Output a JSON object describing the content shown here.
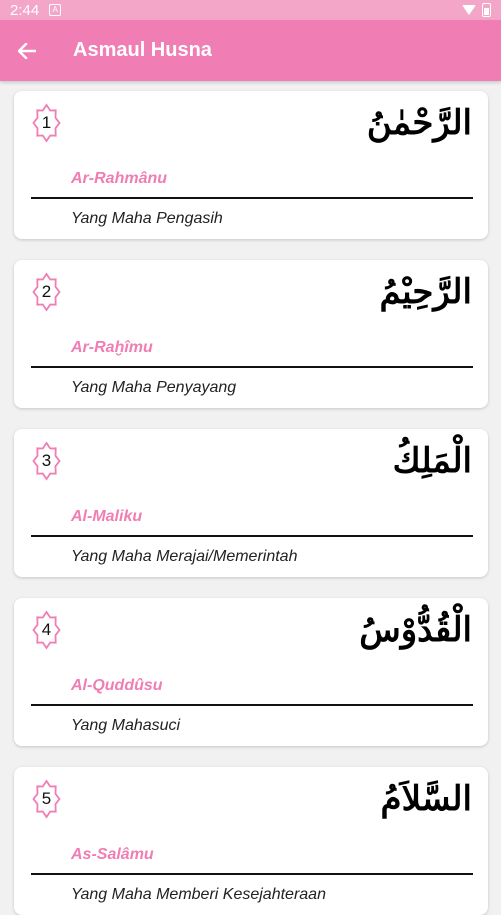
{
  "status_bar": {
    "time": "2:44",
    "sim_glyph": "A"
  },
  "app_bar": {
    "title": "Asmaul Husna",
    "back_icon": "arrow-back-icon"
  },
  "colors": {
    "accent": "#f07db3",
    "status_bar": "#f4a6c8"
  },
  "names": [
    {
      "number": "1",
      "arabic": "الرَّحْمٰنُ",
      "transliteration": "Ar-Rahmânu",
      "meaning": "Yang Maha Pengasih"
    },
    {
      "number": "2",
      "arabic": "الرَّحِيْمُ",
      "transliteration": "Ar-Raḫîmu",
      "meaning": "Yang Maha Penyayang"
    },
    {
      "number": "3",
      "arabic": "الْمَلِكُ",
      "transliteration": "Al-Maliku",
      "meaning": "Yang Maha Merajai/Memerintah"
    },
    {
      "number": "4",
      "arabic": "الْقُدُّوْسُ",
      "transliteration": "Al-Quddûsu",
      "meaning": "Yang Mahasuci"
    },
    {
      "number": "5",
      "arabic": "السَّلاَمُ",
      "transliteration": "As-Salâmu",
      "meaning": "Yang Maha Memberi Kesejahteraan"
    }
  ]
}
